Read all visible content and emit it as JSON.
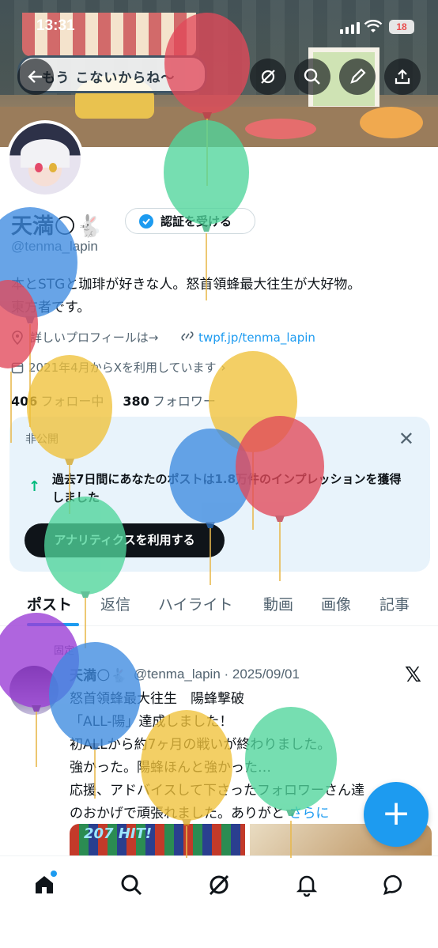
{
  "status_bar": {
    "time": "13:31",
    "battery": "18"
  },
  "banner": {
    "sign_text": "もう こないからね〜"
  },
  "profile": {
    "name": "天満🌕🐇",
    "verify_label": "認証を受ける",
    "handle": "@tenma_lapin",
    "bio_line1": "本とSTGと珈琲が好きな人。怒首領蜂最大往生が大好物。",
    "bio_line2": "東方者です。",
    "profile_link_label": "詳しいプロフィールは→",
    "profile_link_url": "twpf.jp/tenma_lapin",
    "joined": "2021年4月からXを利用しています",
    "following_count": "406",
    "following_label": "フォロー中",
    "followers_count": "380",
    "followers_label": "フォロワー"
  },
  "private_card": {
    "label": "非公開",
    "message": "過去7日間にあなたのポストは1.8万件のインプレッションを獲得しました",
    "button_label": "アナリティクスを利用する"
  },
  "tabs": [
    "ポスト",
    "返信",
    "ハイライト",
    "動画",
    "画像",
    "記事"
  ],
  "post": {
    "pinned_label": "固定",
    "author": "天満🌕🐇",
    "handle_date": "@tenma_lapin · 2025/09/01",
    "lines": [
      "怒首領蜂最大往生　陽蜂撃破",
      "「ALL-陽」達成しました！",
      "初ALLから約7ヶ月の戦いが終わりました。",
      "強かった。陽蜂ほんと強かった…",
      "応援、アドバイスして下さったフォロワーさん達",
      "のおかげで頑張れました。ありがと"
    ],
    "more_label": "さらに",
    "media_score": "207 HIT!"
  },
  "colors": {
    "accent": "#1d9bf0",
    "success": "#00ba7c",
    "text": "#0f1419",
    "muted": "#536471"
  },
  "icons": [
    "back-arrow-icon",
    "grok-icon",
    "search-icon",
    "pen-icon",
    "share-icon",
    "close-icon",
    "home-icon",
    "notifications-icon",
    "messages-icon"
  ]
}
